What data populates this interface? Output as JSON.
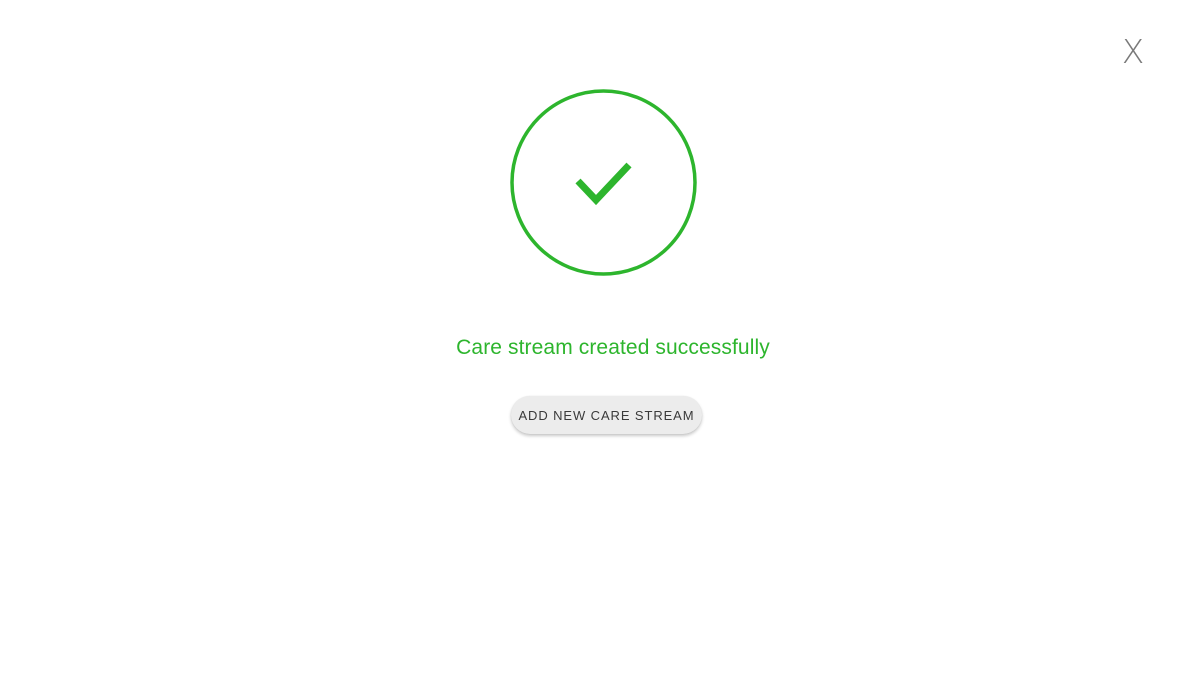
{
  "dialog": {
    "close_label": "X",
    "status_icon": "checkmark-circle-icon",
    "message": "Care stream created successfully",
    "add_button_label": "ADD NEW CARE STREAM"
  },
  "colors": {
    "success": "#2db52d",
    "button_bg": "#ececec",
    "button_text": "#3a3a3a",
    "close_icon": "#7a7a7a"
  }
}
